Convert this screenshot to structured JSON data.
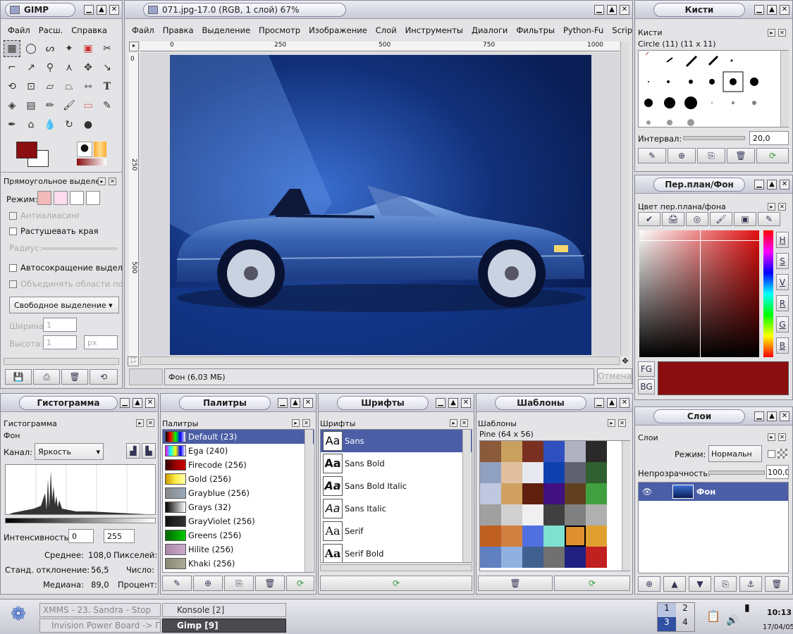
{
  "toolbox": {
    "title": "GIMP",
    "menu": [
      "Файл",
      "Расш.",
      "Справка"
    ],
    "tools": [
      "▭",
      "◯",
      "ᔕ",
      "✎",
      "⊞",
      "✂",
      "⌐",
      "↗",
      "🔍",
      "⋏",
      "✥",
      "↘",
      "⟲",
      "⊡",
      "▱",
      "▭",
      "⇿",
      "T",
      "◈",
      "▤",
      "✏",
      "🖌",
      "▭",
      "✎",
      "✎",
      "⌂",
      "💧",
      "↻",
      "●"
    ]
  },
  "rectsel": {
    "title": "Прямоугольное выделе",
    "mode_label": "Режим:",
    "antialias": "Антиалиасинг",
    "feather": "Растушевать края",
    "radius": "Радиус:",
    "autoshrink": "Автосокращение выделе",
    "merge": "Объединять области по о",
    "freeselect": "Свободное выделение",
    "width": "Ширина:",
    "height": "Высота:",
    "width_val": "1",
    "height_val": "1",
    "unit": "px"
  },
  "image": {
    "title": "071.jpg-17.0 (RGB, 1 слой) 67%",
    "menu": [
      "Файл",
      "Правка",
      "Выделение",
      "Просмотр",
      "Изображение",
      "Слой",
      "Инструменты",
      "Диалоги",
      "Фильтры",
      "Python-Fu",
      "Script-Fu"
    ],
    "ruler_h": [
      "0",
      "250",
      "500",
      "750",
      "1000"
    ],
    "ruler_v": [
      "0",
      "250",
      "500"
    ],
    "status": "Фон (6,03 МБ)",
    "cancel": "Отмена"
  },
  "brushes": {
    "title": "Кисти",
    "panel": "Кисти",
    "current": "Circle (11) (11 x 11)",
    "interval_label": "Интервал:",
    "interval": "20,0"
  },
  "fgbg": {
    "title": "Пер.план/Фон",
    "panel": "Цвет пер.плана/фона",
    "channels": [
      "H",
      "S",
      "V",
      "R",
      "G",
      "B"
    ],
    "fg": "FG",
    "bg": "BG",
    "color": "#8b0e10"
  },
  "histogram": {
    "title": "Гистограмма",
    "panel": "Гистограмма",
    "layer": "Фон",
    "channel_label": "Канал:",
    "channel": "Яркость",
    "intensity_label": "Интенсивность:",
    "int_from": "0",
    "int_to": "255",
    "mean_label": "Среднее:",
    "mean": "108,0",
    "stddev_label": "Станд. отклонение:",
    "stddev": "56,5",
    "median_label": "Медиана:",
    "median": "89,0",
    "pixels_label": "Пикселей:",
    "count_label": "Число:",
    "percent_label": "Процент:"
  },
  "palettes": {
    "title": "Палитры",
    "panel": "Палитры",
    "items": [
      {
        "name": "Default (23)",
        "sel": true,
        "c": "linear-gradient(90deg,#000,#f00,#0f0,#00f,#fff)"
      },
      {
        "name": "Ega (240)",
        "c": "linear-gradient(90deg,#f0f,#0ff,#ff0,#00f,#fff)"
      },
      {
        "name": "Firecode (256)",
        "c": "linear-gradient(90deg,#300,#900,#c00)"
      },
      {
        "name": "Gold (256)",
        "c": "linear-gradient(90deg,#c90,#fe4,#ffa)"
      },
      {
        "name": "Grayblue (256)",
        "c": "linear-gradient(90deg,#888,#9ab)"
      },
      {
        "name": "Grays (32)",
        "c": "linear-gradient(90deg,#000,#fff)"
      },
      {
        "name": "GrayViolet (256)",
        "c": "linear-gradient(90deg,#111,#333)"
      },
      {
        "name": "Greens (256)",
        "c": "linear-gradient(90deg,#060,#0c0)"
      },
      {
        "name": "Hilite (256)",
        "c": "linear-gradient(90deg,#a8a,#cac)"
      },
      {
        "name": "Khaki (256)",
        "c": "linear-gradient(90deg,#887,#aa9)"
      }
    ]
  },
  "fonts": {
    "title": "Шрифты",
    "panel": "Шрифты",
    "items": [
      "Sans",
      "Sans Bold",
      "Sans Bold Italic",
      "Sans Italic",
      "Serif",
      "Serif Bold"
    ],
    "preview": "Aa"
  },
  "patterns": {
    "title": "Шаблоны",
    "panel": "Шаблоны",
    "current": "Pine (64 x 56)"
  },
  "layers": {
    "title": "Слои",
    "panel": "Слои",
    "mode_label": "Режим:",
    "mode": "Нормальн",
    "opacity_label": "Непрозрачность:",
    "opacity": "100,0",
    "layer": "Фон"
  },
  "taskbar": {
    "items": [
      "XMMS - 23. Sandra - Stop",
      "Konsole [2]",
      "Invision Power Board -> П",
      "Gimp [9]"
    ],
    "desktops": [
      "1",
      "2",
      "3",
      "4"
    ],
    "time": "10:13",
    "date": "17/04/05"
  }
}
